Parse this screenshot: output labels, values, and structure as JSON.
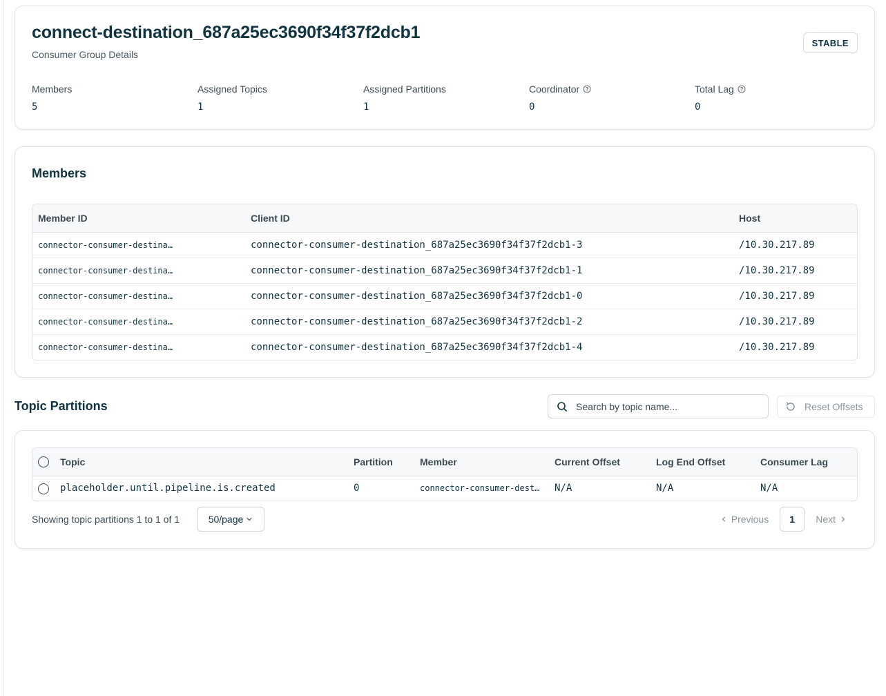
{
  "header": {
    "title": "connect-destination_687a25ec3690f34f37f2dcb1",
    "subtitle": "Consumer Group Details",
    "status": "STABLE",
    "stats": [
      {
        "label": "Members",
        "value": "5",
        "help": false
      },
      {
        "label": "Assigned Topics",
        "value": "1",
        "help": false
      },
      {
        "label": "Assigned Partitions",
        "value": "1",
        "help": false
      },
      {
        "label": "Coordinator",
        "value": "0",
        "help": true
      },
      {
        "label": "Total Lag",
        "value": "0",
        "help": true
      }
    ]
  },
  "members": {
    "title": "Members",
    "columns": [
      "Member ID",
      "Client ID",
      "Host"
    ],
    "rows": [
      {
        "member_id": "connector-consumer-destina…",
        "client_id": "connector-consumer-destination_687a25ec3690f34f37f2dcb1-3",
        "host": "/10.30.217.89"
      },
      {
        "member_id": "connector-consumer-destina…",
        "client_id": "connector-consumer-destination_687a25ec3690f34f37f2dcb1-1",
        "host": "/10.30.217.89"
      },
      {
        "member_id": "connector-consumer-destina…",
        "client_id": "connector-consumer-destination_687a25ec3690f34f37f2dcb1-0",
        "host": "/10.30.217.89"
      },
      {
        "member_id": "connector-consumer-destina…",
        "client_id": "connector-consumer-destination_687a25ec3690f34f37f2dcb1-2",
        "host": "/10.30.217.89"
      },
      {
        "member_id": "connector-consumer-destina…",
        "client_id": "connector-consumer-destination_687a25ec3690f34f37f2dcb1-4",
        "host": "/10.30.217.89"
      }
    ]
  },
  "topic_partitions": {
    "title": "Topic Partitions",
    "search_placeholder": "Search by topic name...",
    "reset_label": "Reset Offsets",
    "columns": [
      "Topic",
      "Partition",
      "Member",
      "Current Offset",
      "Log End Offset",
      "Consumer Lag"
    ],
    "rows": [
      {
        "topic": "placeholder.until.pipeline.is.created",
        "partition": "0",
        "member": "connector-consumer-dest…",
        "current_offset": "N/A",
        "log_end_offset": "N/A",
        "consumer_lag": "N/A"
      }
    ],
    "footer_text": "Showing topic partitions 1 to 1 of 1",
    "page_size": "50/page",
    "prev_label": "Previous",
    "next_label": "Next",
    "current_page": "1"
  },
  "icons": {
    "help": "question-circle-icon",
    "search": "search-icon",
    "reset": "refresh-icon",
    "chevron_down": "chevron-down-icon",
    "chevron_left": "chevron-left-icon",
    "chevron_right": "chevron-right-icon"
  },
  "colors": {
    "text_primary": "#0f3340",
    "text_muted": "#3b4a52",
    "disabled": "#8a969d",
    "border": "#dfe3e7"
  }
}
